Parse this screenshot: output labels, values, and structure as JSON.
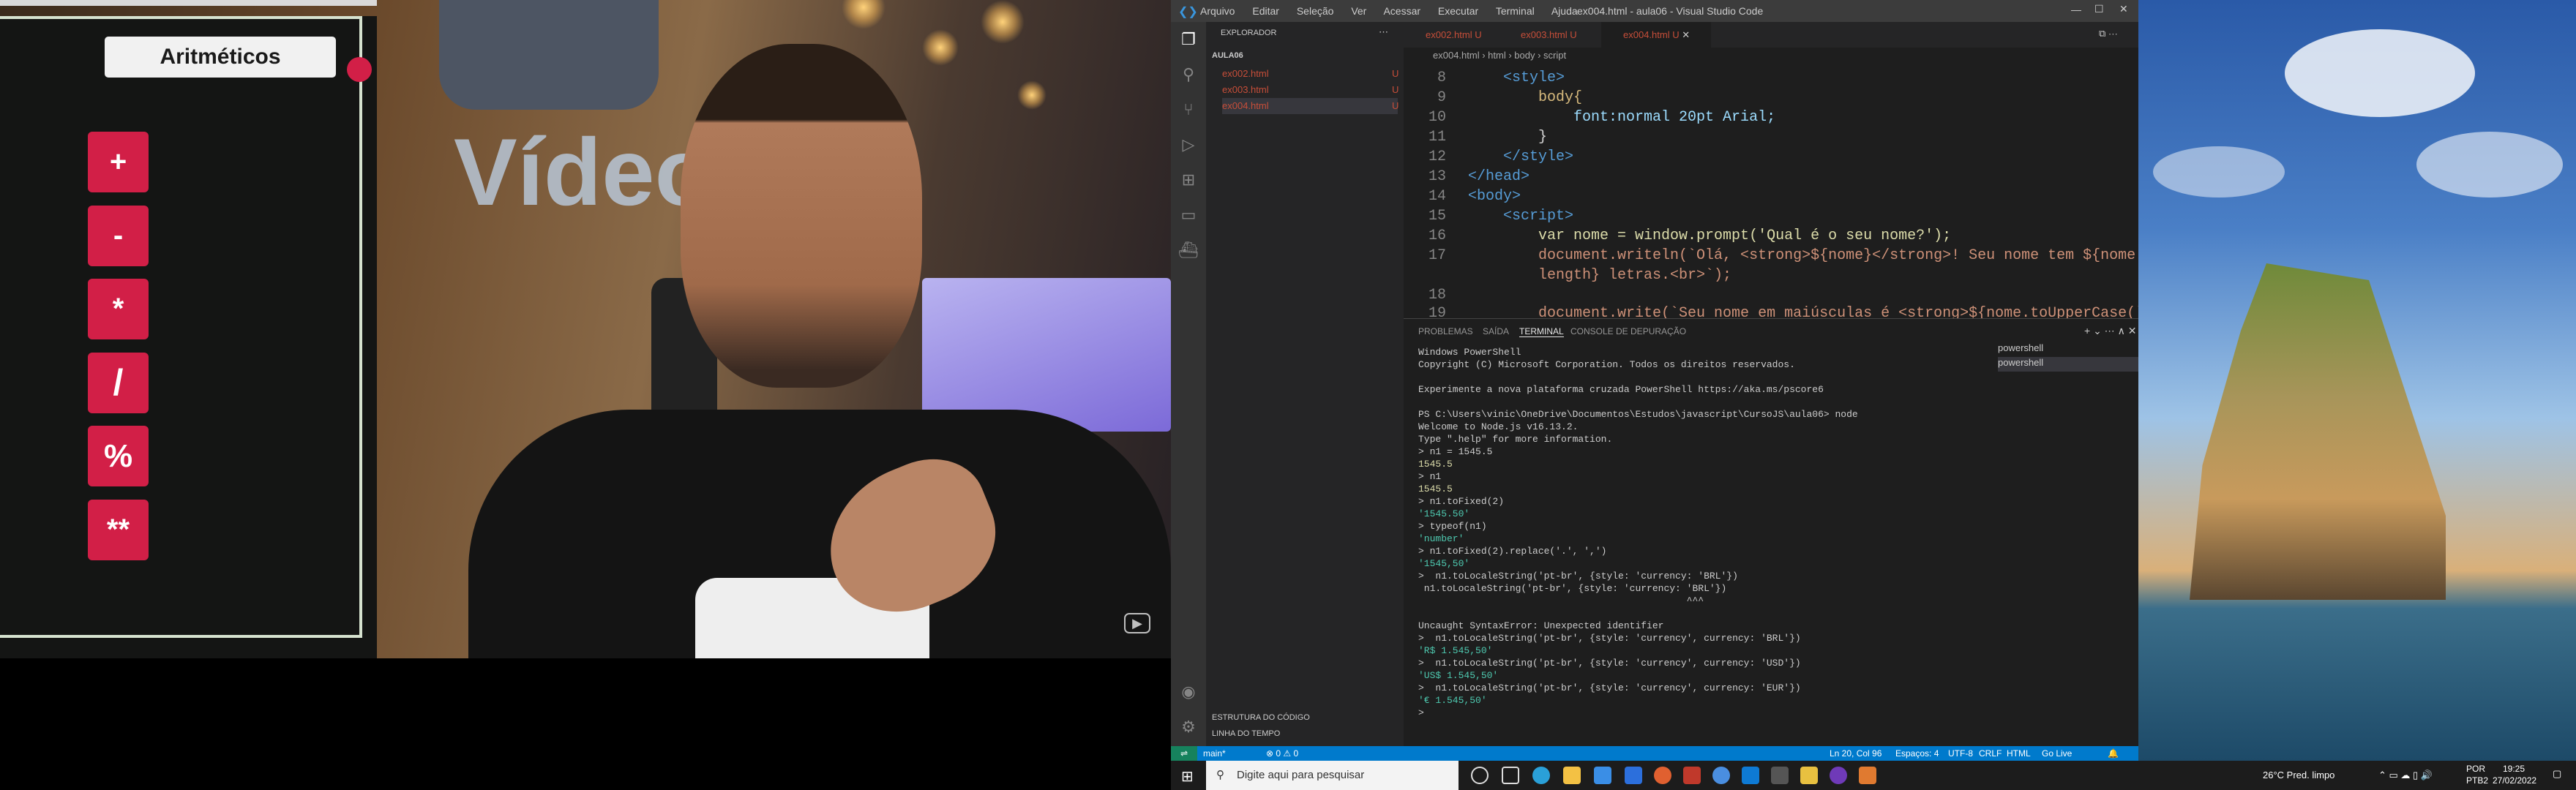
{
  "slide": {
    "title": "Aritméticos",
    "operators": [
      "+",
      "-",
      "*",
      "/",
      "%",
      "**"
    ]
  },
  "video": {
    "background_text": "Vídeo"
  },
  "vscode": {
    "window_title": "ex004.html - aula06 - Visual Studio Code",
    "menu": [
      "Arquivo",
      "Editar",
      "Seleção",
      "Ver",
      "Acessar",
      "Executar",
      "Terminal",
      "Ajuda"
    ],
    "explorer_label": "EXPLORADOR",
    "folder": "AULA06",
    "files": [
      {
        "name": "ex002.html",
        "status": "U"
      },
      {
        "name": "ex003.html",
        "status": "U"
      },
      {
        "name": "ex004.html",
        "status": "U"
      }
    ],
    "outline_label": "ESTRUTURA DO CÓDIGO",
    "timeline_label": "LINHA DO TEMPO",
    "tabs": [
      {
        "name": "ex002.html",
        "status": "U"
      },
      {
        "name": "ex003.html",
        "status": "U"
      },
      {
        "name": "ex004.html",
        "status": "U"
      }
    ],
    "breadcrumb": [
      "ex004.html",
      "html",
      "body",
      "script"
    ],
    "code_lines": [
      {
        "n": "8",
        "text": "    <style>"
      },
      {
        "n": "9",
        "text": "        body{"
      },
      {
        "n": "10",
        "text": "            font:normal 20pt Arial;"
      },
      {
        "n": "11",
        "text": "        }"
      },
      {
        "n": "12",
        "text": "    </style>"
      },
      {
        "n": "13",
        "text": "</head>"
      },
      {
        "n": "14",
        "text": "<body>"
      },
      {
        "n": "15",
        "text": "    <script>"
      },
      {
        "n": "16",
        "text": "        var nome = window.prompt('Qual é o seu nome?');"
      },
      {
        "n": "17",
        "text": "        document.writeln(`Olá, <strong>${nome}</strong>! Seu nome tem ${nome."
      },
      {
        "n": "",
        "text": "        length} letras.<br>`);"
      },
      {
        "n": "18",
        "text": ""
      },
      {
        "n": "19",
        "text": "        document.write(`Seu nome em maiúsculas é <strong>${nome.toUpperCase()}</"
      }
    ],
    "panel_tabs": [
      "PROBLEMAS",
      "SAÍDA",
      "TERMINAL",
      "CONSOLE DE DEPURAÇÃO"
    ],
    "terminal_lines": [
      "Windows PowerShell",
      "Copyright (C) Microsoft Corporation. Todos os direitos reservados.",
      "",
      "Experimente a nova plataforma cruzada PowerShell https://aka.ms/pscore6",
      "",
      "PS C:\\Users\\vinic\\OneDrive\\Documentos\\Estudos\\javascript\\CursoJS\\aula06> node",
      "Welcome to Node.js v16.13.2.",
      "Type \".help\" for more information.",
      "> n1 = 1545.5",
      "1545.5",
      "> n1",
      "1545.5",
      "> n1.toFixed(2)",
      "'1545.50'",
      "> typeof(n1)",
      "'number'",
      "> n1.toFixed(2).replace('.', ',')",
      "'1545,50'",
      ">  n1.toLocaleString('pt-br', {style: 'currency: 'BRL'})",
      " n1.toLocaleString('pt-br', {style: 'currency: 'BRL'})",
      "                                               ^^^",
      "",
      "Uncaught SyntaxError: Unexpected identifier",
      ">  n1.toLocaleString('pt-br', {style: 'currency', currency: 'BRL'})",
      "'R$ 1.545,50'",
      ">  n1.toLocaleString('pt-br', {style: 'currency', currency: 'USD'})",
      "'US$ 1.545,50'",
      ">  n1.toLocaleString('pt-br', {style: 'currency', currency: 'EUR'})",
      "'€ 1.545,50'",
      "> "
    ],
    "terminal_list": [
      "powershell",
      "powershell"
    ],
    "status_left": [
      "main*",
      "⊗ 0 ⚠ 0"
    ],
    "status_right": [
      "Ln 20, Col 96",
      "Espaços: 4",
      "UTF-8",
      "CRLF",
      "HTML",
      "Go Live"
    ]
  },
  "taskbar": {
    "search_placeholder": "Digite aqui para pesquisar",
    "weather": "26°C  Pred. limpo",
    "lang": "POR",
    "lang2": "PTB2",
    "time": "19:25",
    "date": "27/02/2022"
  }
}
